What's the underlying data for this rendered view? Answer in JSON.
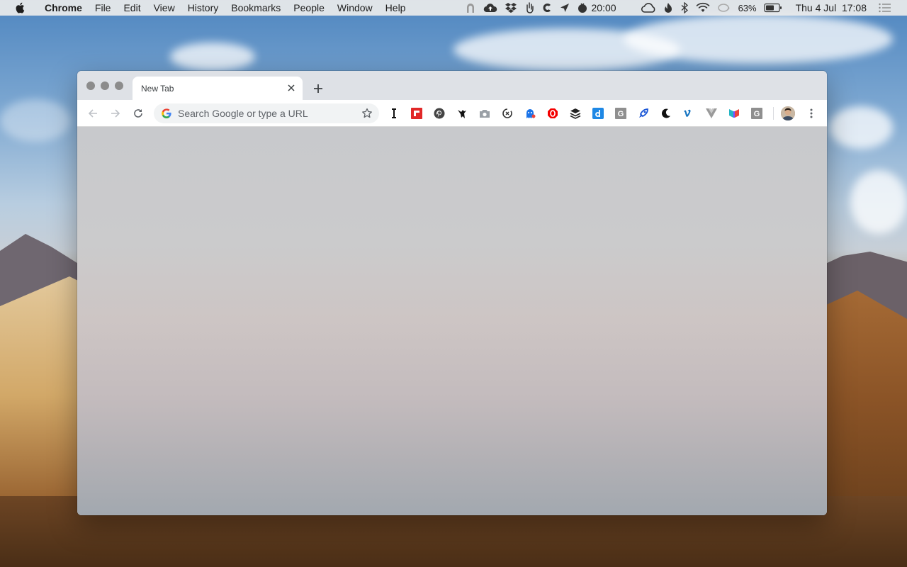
{
  "menubar": {
    "app_name": "Chrome",
    "menus": [
      "File",
      "Edit",
      "View",
      "History",
      "Bookmarks",
      "People",
      "Window",
      "Help"
    ],
    "status": {
      "timer_text": "20:00",
      "battery_percent": "63%",
      "clock": "Thu 4 Jul  17:08"
    }
  },
  "browser": {
    "tab": {
      "title": "New Tab"
    },
    "omnibox": {
      "placeholder": "Search Google or type a URL",
      "value": ""
    },
    "extensions": [
      "instapaper-icon",
      "flipboard-icon",
      "pinterest-icon",
      "bird-icon",
      "camera-icon",
      "sync-icon",
      "ghostery-icon",
      "adblock-icon",
      "buffer-icon",
      "dict-icon",
      "grammarly-gray-icon",
      "rocket-icon",
      "moon-icon",
      "vimeo-icon",
      "vue-devtools-icon",
      "colorful-icon",
      "grammarly-gray-icon-2"
    ]
  },
  "colors": {
    "accent_blue": "#1a73e8",
    "menubar_bg": "#ececec",
    "tabstrip_bg": "#dee1e6",
    "flipboard_red": "#e12828",
    "adblock_red": "#f40000",
    "dict_blue": "#1e88e5"
  }
}
